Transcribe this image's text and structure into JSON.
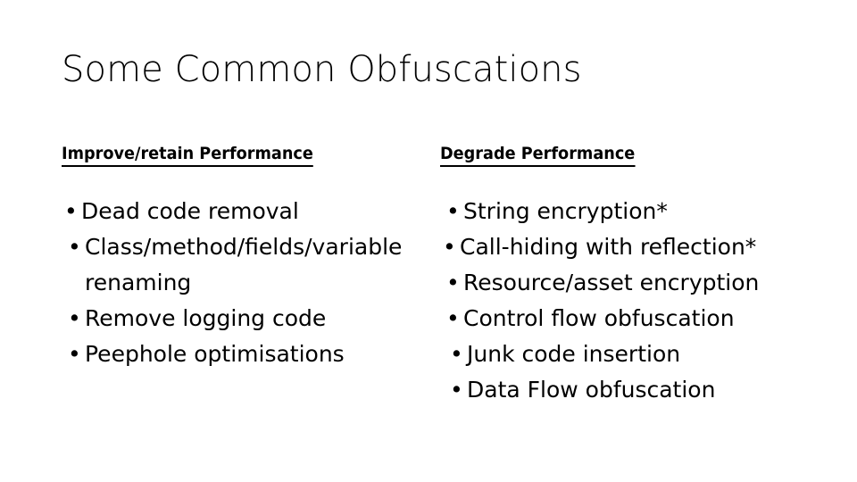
{
  "slide": {
    "title": "Some Common Obfuscations",
    "background_color": "#ffffff",
    "text_color": "#000000"
  },
  "columns": [
    {
      "id": "improve-retain-performance",
      "header": "Improve/retain Performance",
      "bullet_glyph": "•",
      "items": [
        "Dead code removal",
        "Class/method/fields/variable renaming",
        "Remove logging code",
        "Peephole optimisations"
      ]
    },
    {
      "id": "degrade-performance",
      "header": "Degrade Performance",
      "bullet_glyph": "•",
      "items": [
        "String encryption*",
        "Call-hiding with reflection*",
        "Resource/asset encryption",
        "Control flow obfuscation",
        "Junk code insertion",
        "Data Flow obfuscation"
      ]
    }
  ]
}
